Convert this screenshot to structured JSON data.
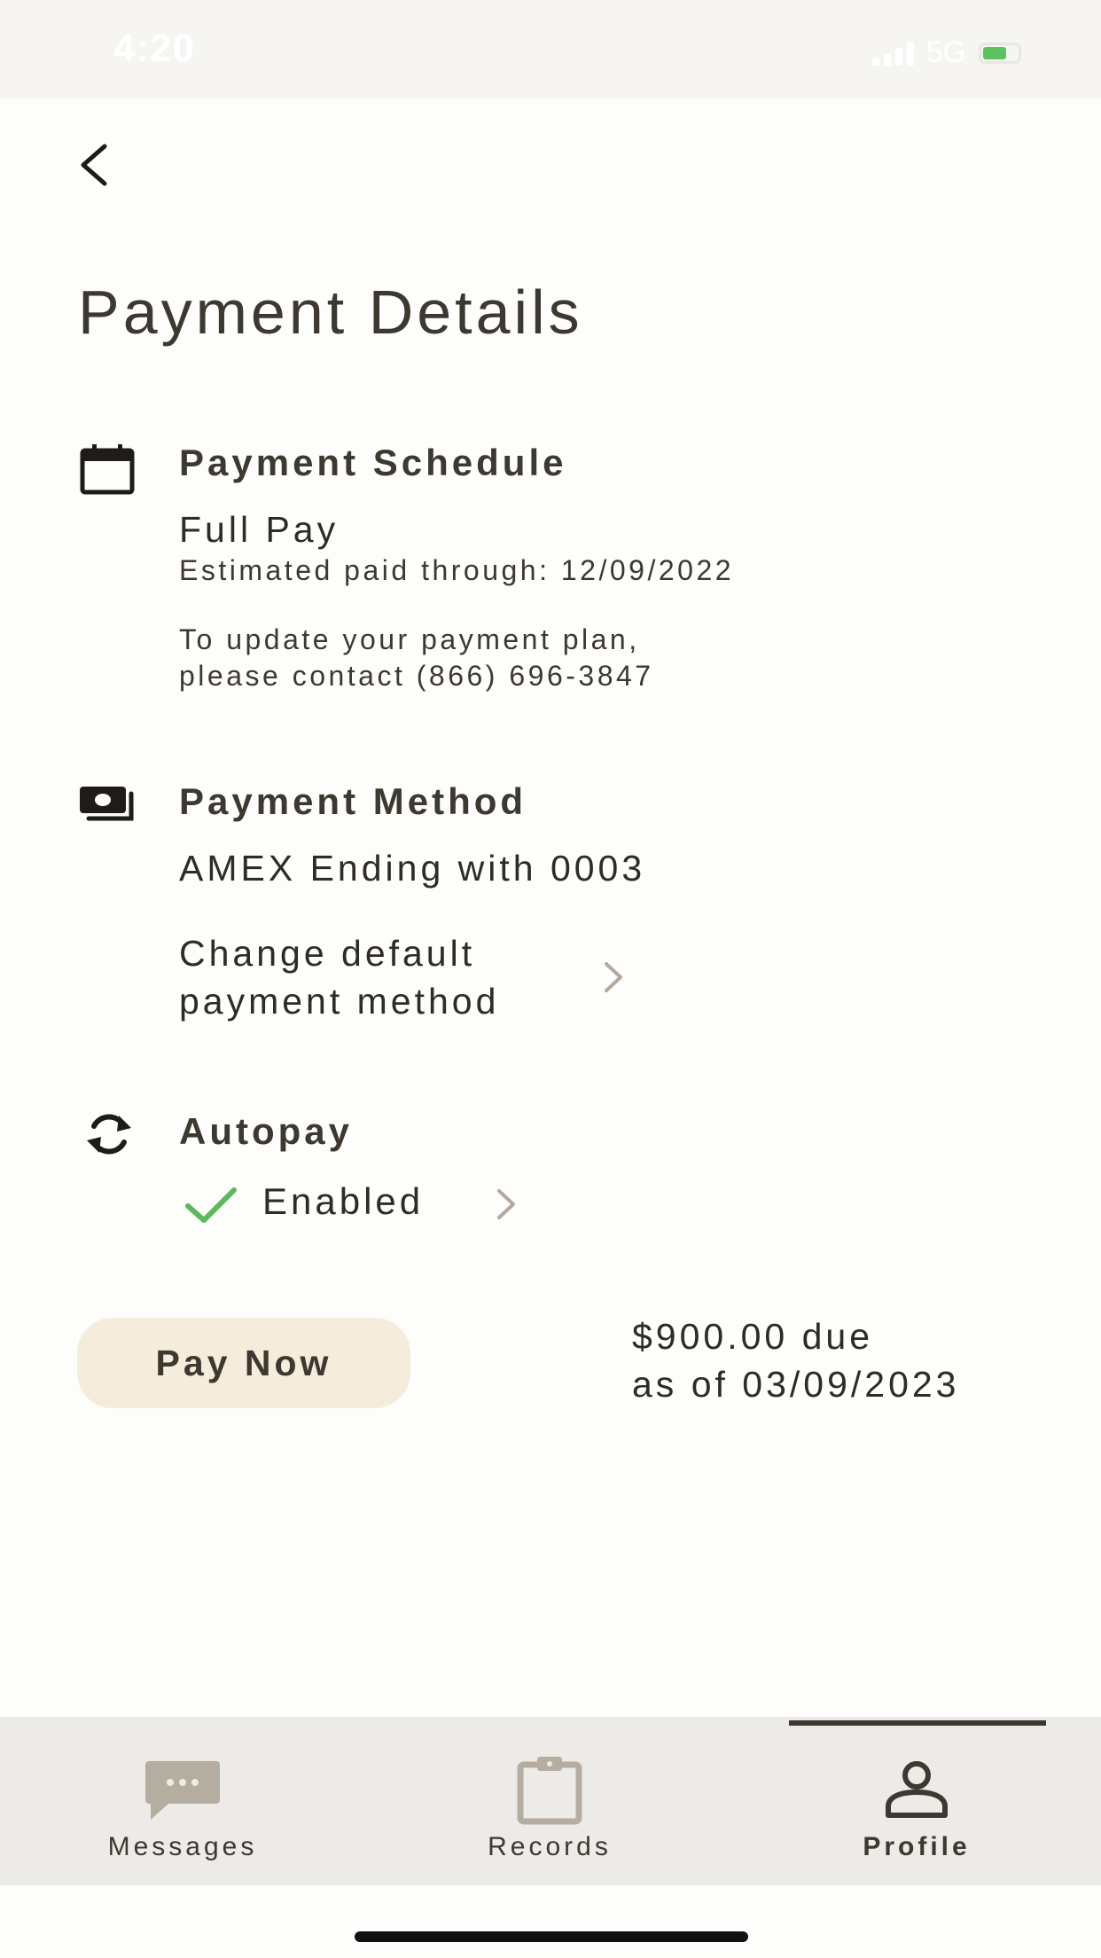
{
  "status_bar": {
    "time": "4:20",
    "network": "5G"
  },
  "page": {
    "title": "Payment Details"
  },
  "schedule": {
    "heading": "Payment Schedule",
    "plan": "Full Pay",
    "paid_through": "Estimated paid through: 12/09/2022",
    "update_line1": "To update your payment plan,",
    "update_line2": "please contact (866) 696-3847"
  },
  "method": {
    "heading": "Payment Method",
    "card": "AMEX Ending with 0003",
    "change_line1": "Change default",
    "change_line2": "payment method"
  },
  "autopay": {
    "heading": "Autopay",
    "status": "Enabled"
  },
  "payment": {
    "button_label": "Pay Now",
    "due_line1": "$900.00 due",
    "due_line2": "as of 03/09/2023"
  },
  "tabs": [
    {
      "label": "Messages",
      "icon": "chat-bubble-icon",
      "active": false
    },
    {
      "label": "Records",
      "icon": "clipboard-icon",
      "active": false
    },
    {
      "label": "Profile",
      "icon": "person-icon",
      "active": true
    }
  ],
  "colors": {
    "text": "#3d3830",
    "accent_button": "#f5ecdb",
    "check": "#5cb85c",
    "chevron": "#b3aa9d",
    "tab_bar": "#ecebe7",
    "inactive_icon": "#b5ada0"
  }
}
